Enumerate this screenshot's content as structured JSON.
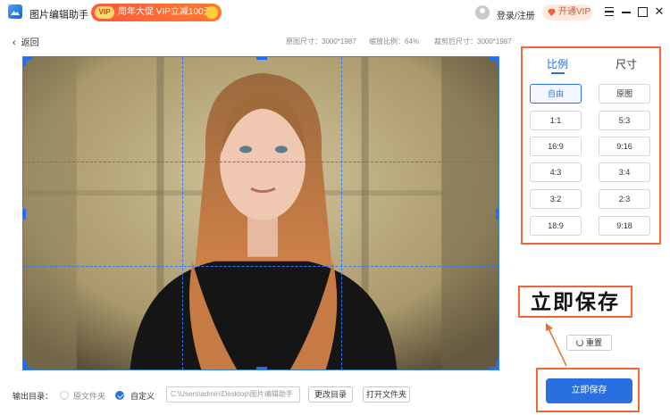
{
  "app": {
    "title": "图片编辑助手"
  },
  "promo": {
    "badge": "VIP",
    "text": "周年大促 VIP立减100元"
  },
  "header": {
    "login": "登录/注册",
    "open_vip": "开通VIP"
  },
  "toolbar": {
    "back": "返回",
    "original_size": "原图尺寸：3000*1987",
    "zoom": "缩放比例：64%",
    "cropped_size": "裁剪后尺寸：3000*1987"
  },
  "panel": {
    "tabs": [
      "比例",
      "尺寸"
    ],
    "ratios": [
      "自由",
      "原图",
      "1:1",
      "5:3",
      "16:9",
      "9:16",
      "4:3",
      "3:4",
      "3:2",
      "2:3",
      "18:9",
      "9:18"
    ],
    "active_ratio": "自由"
  },
  "annotation": "立即保存",
  "reset": "重置",
  "output": {
    "label": "输出目录：",
    "options": [
      "原文件夹",
      "自定义"
    ],
    "path": "C:\\Users\\admin\\Desktop\\图片编辑助手",
    "change_dir": "更改目录",
    "open_folder": "打开文件夹"
  },
  "save_button": "立即保存",
  "colors": {
    "accent": "#2a6fe0",
    "highlight": "#f06a35"
  }
}
